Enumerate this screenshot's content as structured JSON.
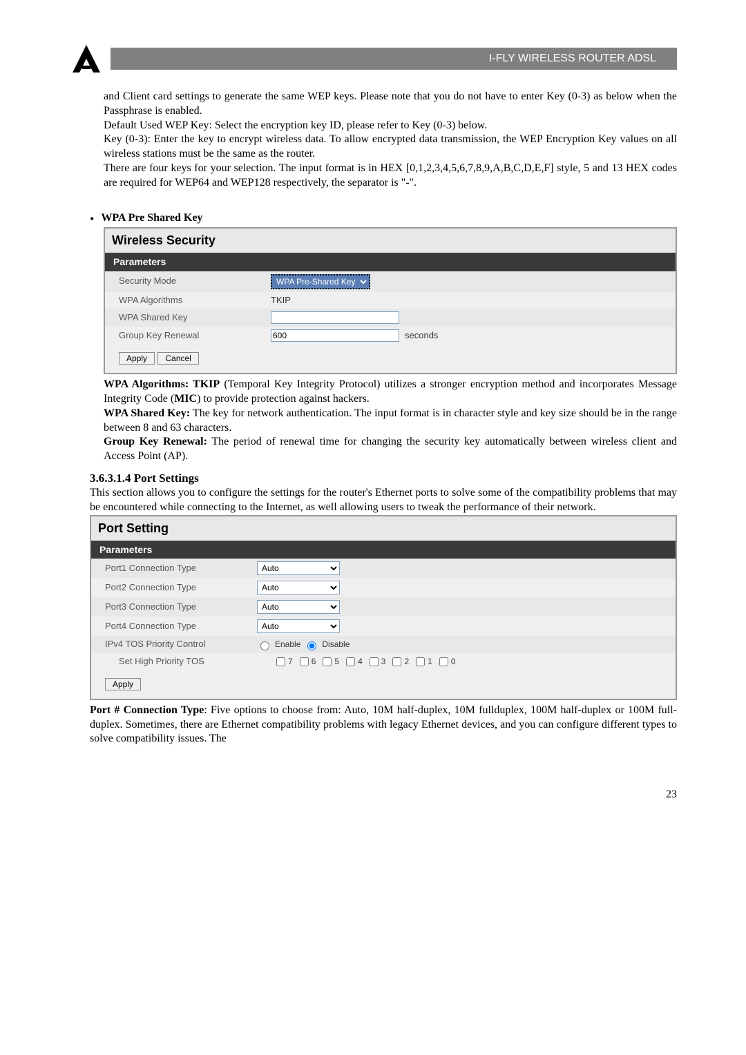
{
  "header": {
    "title": "I-FLY WIRELESS ROUTER ADSL"
  },
  "intro": {
    "p1": "and Client card settings to generate the same WEP keys. Please note that you do not have to enter Key (0-3) as below when the Passphrase is enabled.",
    "p2": "Default Used WEP Key: Select the encryption key ID, please refer to Key (0-3) below.",
    "p3": "Key (0-3): Enter the key to encrypt wireless data. To allow encrypted data transmission, the WEP Encryption Key values on all wireless stations must be the same as the router.",
    "p4": "There are four keys for your selection. The input format is in HEX [0,1,2,3,4,5,6,7,8,9,A,B,C,D,E,F] style, 5 and 13 HEX codes are required for WEP64 and WEP128 respectively, the separator is \"-\"."
  },
  "wpa": {
    "bullet_title": "WPA Pre Shared Key",
    "panel_title": "Wireless Security",
    "parameters_label": "Parameters",
    "rows": {
      "security_mode_label": "Security Mode",
      "security_mode_value": "WPA Pre-Shared Key",
      "wpa_algorithms_label": "WPA Algorithms",
      "wpa_algorithms_value": "TKIP",
      "wpa_shared_key_label": "WPA Shared Key",
      "wpa_shared_key_value": "",
      "group_key_renewal_label": "Group Key Renewal",
      "group_key_renewal_value": "600",
      "group_key_renewal_unit": "seconds"
    },
    "buttons": {
      "apply": "Apply",
      "cancel": "Cancel"
    },
    "desc": {
      "algo_label": "WPA Algorithms: TKIP",
      "algo_text": " (Temporal Key Integrity Protocol) utilizes a stronger encryption method and incorporates Message Integrity Code (",
      "mic": "MIC",
      "algo_text2": ") to provide protection against hackers.",
      "shared_key_label": "WPA Shared Key:",
      "shared_key_text": " The key for network authentication. The input format is in character style and key size should be in the range between 8 and 63 characters.",
      "group_key_label": "Group Key Renewal:",
      "group_key_text": " The period of renewal time for changing the security key automatically between wireless client and Access Point (AP)."
    }
  },
  "port": {
    "heading": "3.6.3.1.4 Port Settings",
    "intro": "This section allows you to configure the settings for the router's Ethernet ports to solve some of the compatibility problems that may be encountered while connecting to the Internet, as well allowing users to tweak the performance of their network.",
    "panel_title": "Port Setting",
    "parameters_label": "Parameters",
    "rows": {
      "port1_label": "Port1 Connection Type",
      "port1_value": "Auto",
      "port2_label": "Port2 Connection Type",
      "port2_value": "Auto",
      "port3_label": "Port3 Connection Type",
      "port3_value": "Auto",
      "port4_label": "Port4 Connection Type",
      "port4_value": "Auto",
      "ipv4_label": "IPv4 TOS Priority Control",
      "enable_label": "Enable",
      "disable_label": "Disable",
      "high_priority_label": "Set High Priority TOS",
      "tos_values": [
        "7",
        "6",
        "5",
        "4",
        "3",
        "2",
        "1",
        "0"
      ]
    },
    "buttons": {
      "apply": "Apply"
    },
    "desc": {
      "label": "Port # Connection Type",
      "text": ": Five options to choose from: Auto, 10M half-duplex, 10M fullduplex, 100M half-duplex or 100M full-duplex. Sometimes, there are Ethernet compatibility problems with legacy Ethernet devices, and you can configure different types to solve compatibility issues. The"
    }
  },
  "page_number": "23"
}
